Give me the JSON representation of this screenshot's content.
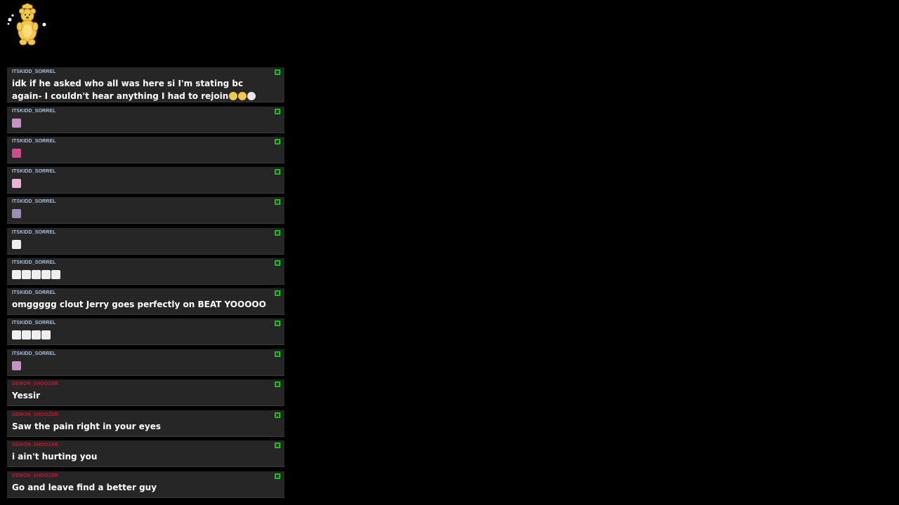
{
  "colors": {
    "page_bg": "#000000",
    "message_bg": "#262626",
    "user_itskidd": "#a9c1de",
    "user_demon": "#d0112b",
    "badge": "#1fd11f",
    "text": "#ffffff"
  },
  "mascot": {
    "icon": "gold-bear-icon"
  },
  "messages": [
    {
      "user": "ITSKIDD_SORREL",
      "kind": "text",
      "text": "idk if he asked who all was here si I'm stating bc again- I couldn't hear anything I had to rejoin",
      "emotes": [
        "face-emoji",
        "crying-laughing-emoji",
        "skull-emoji"
      ]
    },
    {
      "user": "ITSKIDD_SORREL",
      "kind": "emote",
      "text": "",
      "emotes": [
        "pink-sticker-emote"
      ]
    },
    {
      "user": "ITSKIDD_SORREL",
      "kind": "emote",
      "text": "",
      "emotes": [
        "lips-emote"
      ]
    },
    {
      "user": "ITSKIDD_SORREL",
      "kind": "emote",
      "text": "",
      "emotes": [
        "pink-character-emote"
      ]
    },
    {
      "user": "ITSKIDD_SORREL",
      "kind": "emote",
      "text": "",
      "emotes": [
        "sparkle-emote"
      ]
    },
    {
      "user": "ITSKIDD_SORREL",
      "kind": "emote",
      "text": "",
      "emotes": [
        "ghost-emote"
      ]
    },
    {
      "user": "ITSKIDD_SORREL",
      "kind": "emote",
      "text": "",
      "emotes": [
        "ghost-emote",
        "ghost-emote",
        "ghost-emote",
        "ghost-emote",
        "ghost-emote"
      ]
    },
    {
      "user": "ITSKIDD_SORREL",
      "kind": "text",
      "text": "omggggg clout Jerry goes perfectly on BEAT YOOOOO",
      "emotes": []
    },
    {
      "user": "ITSKIDD_SORREL",
      "kind": "emote",
      "text": "",
      "emotes": [
        "ghost-emote",
        "ghost-emote",
        "ghost-emote",
        "ghost-emote"
      ]
    },
    {
      "user": "ITSKIDD_SORREL",
      "kind": "emote",
      "text": "",
      "emotes": [
        "pink-sticker-emote"
      ]
    },
    {
      "user": "DEMON_SHOOZER",
      "kind": "text",
      "text": "Yessir",
      "emotes": []
    },
    {
      "user": "DEMON_SHOOZER",
      "kind": "text",
      "text": "Saw the pain right in your eyes",
      "emotes": []
    },
    {
      "user": "DEMON_SHOOZER",
      "kind": "text",
      "text": "i ain't hurting you",
      "emotes": []
    },
    {
      "user": "DEMON_SHOOZER",
      "kind": "text",
      "text": "Go and leave find a better guy",
      "emotes": []
    }
  ]
}
